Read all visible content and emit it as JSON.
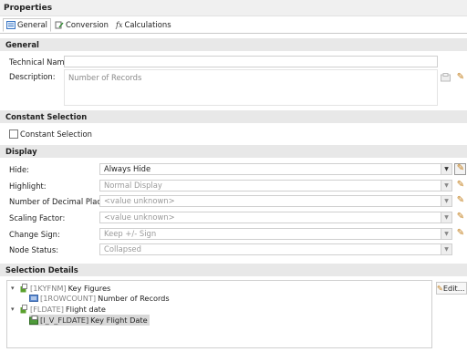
{
  "panel": {
    "title": "Properties"
  },
  "tabs": [
    {
      "label": "General",
      "icon": "general-icon",
      "active": true
    },
    {
      "label": "Conversion",
      "icon": "conversion-icon"
    },
    {
      "label": "Calculations",
      "icon": "fx-icon",
      "icon_text": "fx"
    }
  ],
  "general": {
    "section_title": "General",
    "technical_name_label": "Technical Name:",
    "technical_name_value": "",
    "description_label": "Description:",
    "description_value": "Number of Records"
  },
  "constant_selection": {
    "section_title": "Constant Selection",
    "checkbox_label": "Constant Selection",
    "checked": false
  },
  "display": {
    "section_title": "Display",
    "rows": [
      {
        "label": "Hide:",
        "value": "Always Hide"
      },
      {
        "label": "Highlight:",
        "value": "Normal Display"
      },
      {
        "label": "Number of Decimal Places:",
        "value": "<value unknown>"
      },
      {
        "label": "Scaling Factor:",
        "value": "<value unknown>"
      },
      {
        "label": "Change Sign:",
        "value": "Keep +/- Sign"
      },
      {
        "label": "Node Status:",
        "value": "Collapsed"
      }
    ]
  },
  "selection_details": {
    "section_title": "Selection Details",
    "edit_button": "Edit...",
    "tree": [
      {
        "id": "[1KYFNM]",
        "name": "Key Figures",
        "expander": "▾"
      },
      {
        "id": "[1ROWCOUNT]",
        "name": "Number of Records"
      },
      {
        "id": "[FLDATE]",
        "name": "Flight date",
        "expander": "▾"
      },
      {
        "id": "[I_V_FLDATE]",
        "name": "Key Flight Date"
      }
    ]
  },
  "colors": {
    "section_bg": "#e8e8e8",
    "pencil": "#c07a14",
    "selected_row": "#d8d8d8"
  }
}
